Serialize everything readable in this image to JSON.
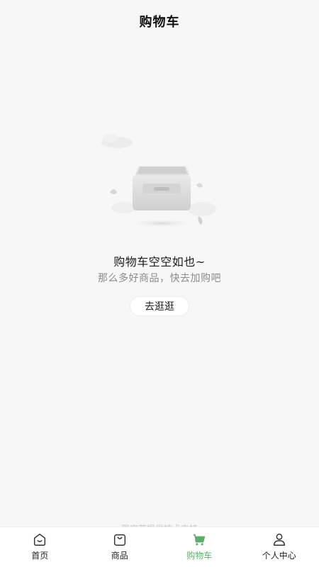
{
  "header": {
    "title": "购物车"
  },
  "empty_state": {
    "illustration": "empty-box-icon",
    "title": "购物车空空如也~",
    "subtitle": "那么多好商品，快去加购吧",
    "button_label": "去逛逛"
  },
  "footer": {
    "support_text": "聚宝荟提供技术支持"
  },
  "tabbar": {
    "active_color": "#5cae6a",
    "items": [
      {
        "label": "首页",
        "icon": "home-icon"
      },
      {
        "label": "商品",
        "icon": "bag-icon"
      },
      {
        "label": "购物车",
        "icon": "cart-icon",
        "active": true
      },
      {
        "label": "个人中心",
        "icon": "user-icon"
      }
    ]
  }
}
